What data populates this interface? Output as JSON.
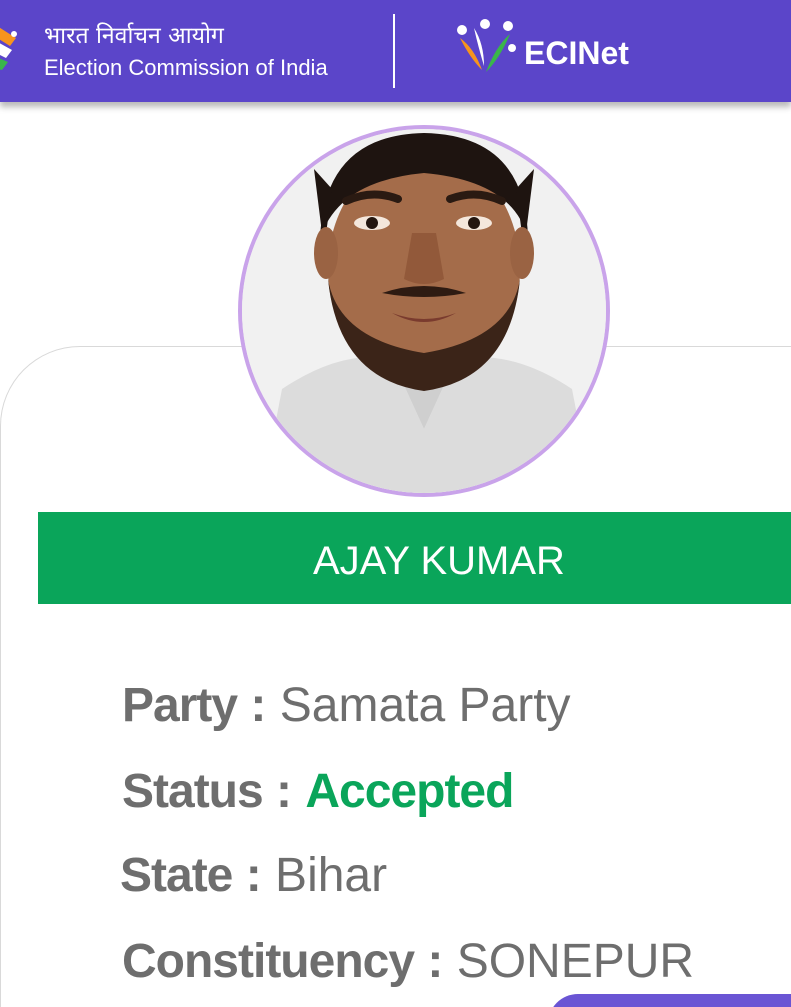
{
  "header": {
    "hindi_name": "भारत निर्वाचन आयोग",
    "english_name": "Election Commission of India",
    "app_name": "ECINet",
    "color": "#5b45c9"
  },
  "candidate": {
    "name": "AJAY KUMAR",
    "name_bar_color": "#0aa55a",
    "details": [
      {
        "label": "Party",
        "separator": ":",
        "value": "Samata Party"
      },
      {
        "label": "Status",
        "separator": ":",
        "value": "Accepted",
        "value_color": "#0aa55a"
      },
      {
        "label": "State",
        "separator": ":",
        "value": "Bihar"
      },
      {
        "label": "Constituency",
        "separator": ":",
        "value": "SONEPUR"
      }
    ]
  },
  "icons": [
    "eci-logo-icon",
    "ecinet-logo-icon",
    "candidate-photo"
  ]
}
